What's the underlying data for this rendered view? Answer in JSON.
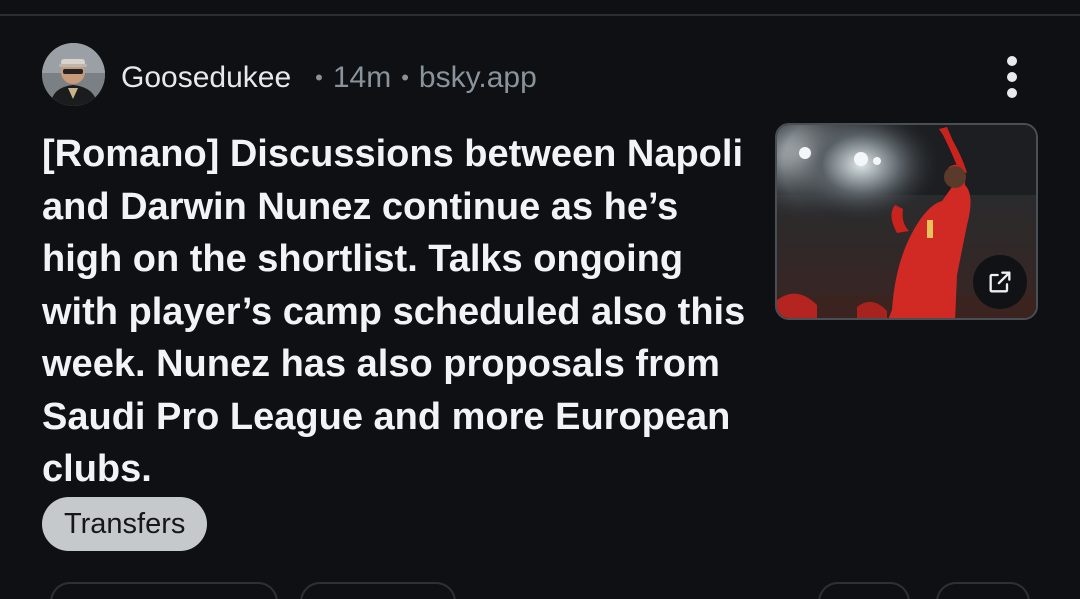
{
  "post": {
    "author": "Goosedukee",
    "separator": "•",
    "time": "14m",
    "source": "bsky.app",
    "text": "[Romano] Discussions between Napoli and Darwin Nunez continue as he’s high on the shortlist. Talks ongoing with player’s camp scheduled also this week. Nunez has also proposals from Saudi Pro League and more European clubs.",
    "tag": "Transfers"
  },
  "icons": {
    "menu": "more-vertical-icon",
    "external": "external-link-icon"
  },
  "colors": {
    "background": "#0e1013",
    "text": "#f1f3f5",
    "muted": "#8a939c",
    "tag_bg": "#c6c9cc"
  }
}
